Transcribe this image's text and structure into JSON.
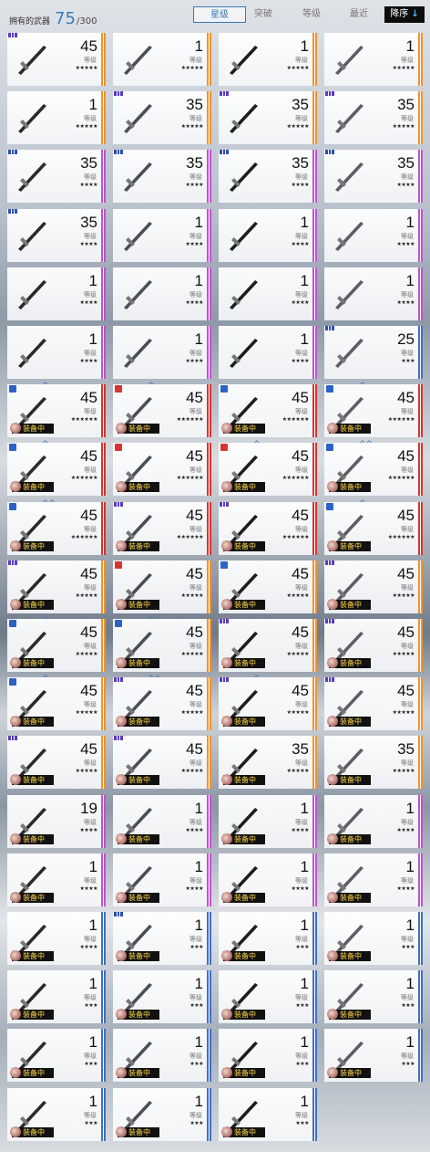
{
  "header": {
    "owned_label": "拥有的武器",
    "owned_count": "75",
    "owned_max": "/300",
    "tabs": [
      {
        "label": "星级",
        "active": true
      },
      {
        "label": "突破",
        "active": false
      },
      {
        "label": "等级",
        "active": false
      },
      {
        "label": "最近",
        "active": false
      }
    ],
    "sort_label": "降序",
    "sort_icon": "arrow-down-icon"
  },
  "level_label": "等级",
  "equip_label": "装备中",
  "colors": {
    "orange": "#f2922c",
    "purple": "#c052d0",
    "red": "#d8342f",
    "blue": "#3f6fc4",
    "accent": "#3a78b8"
  },
  "weapons": [
    {
      "level": "45",
      "stars": "★★★★★",
      "color": "orange",
      "tag": "purple"
    },
    {
      "level": "1",
      "stars": "★★★★★",
      "color": "orange"
    },
    {
      "level": "1",
      "stars": "★★★★★",
      "color": "orange"
    },
    {
      "level": "1",
      "stars": "★★★★★",
      "color": "orange"
    },
    {
      "level": "1",
      "stars": "★★★★★",
      "color": "orange"
    },
    {
      "level": "35",
      "stars": "★★★★★",
      "color": "orange",
      "tag": "purple"
    },
    {
      "level": "35",
      "stars": "★★★★★",
      "color": "orange",
      "tag": "purple"
    },
    {
      "level": "35",
      "stars": "★★★★★",
      "color": "orange",
      "tag": "purple"
    },
    {
      "level": "35",
      "stars": "★★★★",
      "color": "purple",
      "tag": "blue"
    },
    {
      "level": "35",
      "stars": "★★★★",
      "color": "purple",
      "tag": "blue"
    },
    {
      "level": "35",
      "stars": "★★★★",
      "color": "purple",
      "tag": "blue"
    },
    {
      "level": "35",
      "stars": "★★★★",
      "color": "purple",
      "tag": "blue"
    },
    {
      "level": "35",
      "stars": "★★★★",
      "color": "purple",
      "tag": "blue"
    },
    {
      "level": "1",
      "stars": "★★★★",
      "color": "purple"
    },
    {
      "level": "1",
      "stars": "★★★★",
      "color": "purple"
    },
    {
      "level": "1",
      "stars": "★★★★",
      "color": "purple"
    },
    {
      "level": "1",
      "stars": "★★★★",
      "color": "purple"
    },
    {
      "level": "1",
      "stars": "★★★★",
      "color": "purple"
    },
    {
      "level": "1",
      "stars": "★★★★",
      "color": "purple"
    },
    {
      "level": "1",
      "stars": "★★★★",
      "color": "purple"
    },
    {
      "level": "1",
      "stars": "★★★★",
      "color": "purple"
    },
    {
      "level": "1",
      "stars": "★★★★",
      "color": "purple"
    },
    {
      "level": "1",
      "stars": "★★★★",
      "color": "purple"
    },
    {
      "level": "25",
      "stars": "★★★",
      "color": "blue",
      "tag": "blue"
    },
    {
      "level": "45",
      "stars": "★★★★★★",
      "color": "red",
      "lock": "blue",
      "equip": true,
      "up": "^"
    },
    {
      "level": "45",
      "stars": "★★★★★★",
      "color": "red",
      "lock": "red",
      "equip": true,
      "up": "^"
    },
    {
      "level": "45",
      "stars": "★★★★★★",
      "color": "red",
      "lock": "blue",
      "equip": true
    },
    {
      "level": "45",
      "stars": "★★★★★★",
      "color": "red",
      "lock": "blue",
      "equip": true,
      "up": "^"
    },
    {
      "level": "45",
      "stars": "★★★★★★",
      "color": "red",
      "lock": "blue",
      "equip": true,
      "up": "^"
    },
    {
      "level": "45",
      "stars": "★★★★★★",
      "color": "red",
      "lock": "red",
      "equip": true
    },
    {
      "level": "45",
      "stars": "★★★★★★",
      "color": "red",
      "lock": "red",
      "equip": true,
      "up": "^"
    },
    {
      "level": "45",
      "stars": "★★★★★★",
      "color": "red",
      "lock": "blue",
      "equip": true,
      "up": "^^"
    },
    {
      "level": "45",
      "stars": "★★★★★★",
      "color": "red",
      "lock": "blue",
      "equip": true,
      "up": "^^"
    },
    {
      "level": "45",
      "stars": "★★★★★★",
      "color": "red",
      "tag": "purple",
      "equip": true
    },
    {
      "level": "45",
      "stars": "★★★★★★",
      "color": "red",
      "tag": "purple",
      "equip": true
    },
    {
      "level": "45",
      "stars": "★★★★★★",
      "color": "red",
      "lock": "blue",
      "equip": true,
      "up": "^"
    },
    {
      "level": "45",
      "stars": "★★★★★",
      "color": "orange",
      "tag": "purple",
      "equip": true
    },
    {
      "level": "45",
      "stars": "★★★★★",
      "color": "orange",
      "lock": "red",
      "equip": true
    },
    {
      "level": "45",
      "stars": "★★★★★",
      "color": "orange",
      "lock": "blue",
      "equip": true
    },
    {
      "level": "45",
      "stars": "★★★★★",
      "color": "orange",
      "tag": "purple",
      "equip": true
    },
    {
      "level": "45",
      "stars": "★★★★★",
      "color": "orange",
      "lock": "blue",
      "equip": true,
      "up": "^"
    },
    {
      "level": "45",
      "stars": "★★★★★",
      "color": "orange",
      "lock": "blue",
      "equip": true,
      "up": "^"
    },
    {
      "level": "45",
      "stars": "★★★★★",
      "color": "orange",
      "tag": "purple",
      "equip": true
    },
    {
      "level": "45",
      "stars": "★★★★★",
      "color": "orange",
      "tag": "purple",
      "equip": true
    },
    {
      "level": "45",
      "stars": "★★★★★",
      "color": "orange",
      "lock": "blue",
      "equip": true,
      "up": "^"
    },
    {
      "level": "45",
      "stars": "★★★★★",
      "color": "orange",
      "tag": "purple",
      "equip": true,
      "up": "^^"
    },
    {
      "level": "45",
      "stars": "★★★★★",
      "color": "orange",
      "tag": "purple",
      "equip": true,
      "up": "^"
    },
    {
      "level": "45",
      "stars": "★★★★★",
      "color": "orange",
      "tag": "purple",
      "equip": true
    },
    {
      "level": "45",
      "stars": "★★★★★",
      "color": "orange",
      "tag": "purple",
      "equip": true
    },
    {
      "level": "45",
      "stars": "★★★★★",
      "color": "orange",
      "tag": "purple",
      "equip": true
    },
    {
      "level": "35",
      "stars": "★★★★★",
      "color": "orange",
      "equip": true
    },
    {
      "level": "35",
      "stars": "★★★★★",
      "color": "orange",
      "equip": true
    },
    {
      "level": "19",
      "stars": "★★★★",
      "color": "purple",
      "equip": true
    },
    {
      "level": "1",
      "stars": "★★★★",
      "color": "purple",
      "equip": true
    },
    {
      "level": "1",
      "stars": "★★★★",
      "color": "purple",
      "equip": true
    },
    {
      "level": "1",
      "stars": "★★★★",
      "color": "purple",
      "equip": true
    },
    {
      "level": "1",
      "stars": "★★★★",
      "color": "purple",
      "equip": true
    },
    {
      "level": "1",
      "stars": "★★★★",
      "color": "purple",
      "equip": true
    },
    {
      "level": "1",
      "stars": "★★★★",
      "color": "purple",
      "equip": true
    },
    {
      "level": "1",
      "stars": "★★★★",
      "color": "purple",
      "equip": true
    },
    {
      "level": "1",
      "stars": "★★★★",
      "color": "blue",
      "equip": true
    },
    {
      "level": "1",
      "stars": "★★★",
      "color": "blue",
      "tag": "blue",
      "equip": true
    },
    {
      "level": "1",
      "stars": "★★★",
      "color": "blue",
      "equip": true
    },
    {
      "level": "1",
      "stars": "★★★",
      "color": "blue",
      "equip": true
    },
    {
      "level": "1",
      "stars": "★★★",
      "color": "blue",
      "equip": true
    },
    {
      "level": "1",
      "stars": "★★★",
      "color": "blue",
      "equip": true
    },
    {
      "level": "1",
      "stars": "★★★",
      "color": "blue",
      "equip": true
    },
    {
      "level": "1",
      "stars": "★★★",
      "color": "blue",
      "equip": true
    },
    {
      "level": "1",
      "stars": "★★★",
      "color": "blue",
      "equip": true
    },
    {
      "level": "1",
      "stars": "★★★",
      "color": "blue",
      "equip": true
    },
    {
      "level": "1",
      "stars": "★★★",
      "color": "blue",
      "equip": true
    },
    {
      "level": "1",
      "stars": "★★★",
      "color": "blue",
      "equip": true
    },
    {
      "level": "1",
      "stars": "★★★",
      "color": "blue",
      "equip": true
    },
    {
      "level": "1",
      "stars": "★★★",
      "color": "blue",
      "equip": true
    },
    {
      "level": "1",
      "stars": "★★★",
      "color": "blue",
      "equip": true
    }
  ]
}
